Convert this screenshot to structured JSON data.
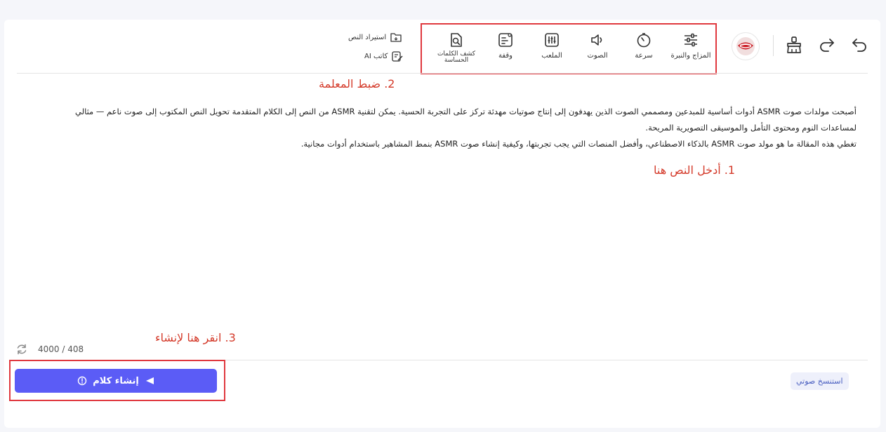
{
  "toolbar": {
    "items": [
      {
        "label": "المزاج والنبرة",
        "icon": "sliders-icon"
      },
      {
        "label": "سرعة",
        "icon": "timer-icon"
      },
      {
        "label": "الصوت",
        "icon": "speaker-icon"
      },
      {
        "label": "الملعب",
        "icon": "equalizer-icon"
      },
      {
        "label": "وقفة",
        "icon": "pause-insert-icon"
      },
      {
        "label": "كشف الكلمات الحساسة",
        "icon": "document-search-icon"
      }
    ],
    "import_text": "استيراد النص",
    "ai_writer": "كاتب AI"
  },
  "editor": {
    "lines": [
      "أصبحت مولدات صوت ASMR أدوات أساسية للمبدعين ومصممي الصوت الذين يهدفون إلى إنتاج صوتيات مهدئة تركز على التجربة الحسية. يمكن لتقنية ASMR من النص إلى الكلام المتقدمة تحويل النص المكتوب إلى صوت ناعم — مثالي",
      "لمساعدات النوم ومحتوى التأمل والموسيقى التصويرية المريحة.",
      "تغطي هذه المقالة ما هو مولد صوت ASMR بالذكاء الاصطناعي، وأفضل المنصات التي يجب تجربتها، وكيفية إنشاء صوت ASMR بنمط المشاهير باستخدام أدوات مجانية."
    ],
    "char_count": "4000 / 408"
  },
  "annotations": {
    "step1": "1. أدخل النص هنا",
    "step2": "2. ضبط المعلمة",
    "step3": "3. انقر هنا لإنشاء"
  },
  "footer": {
    "generate_label": "إنشاء كلام",
    "voice_clone_label": "استنسخ صوتي"
  },
  "colors": {
    "accent": "#5b5cf6",
    "annotation": "#e0383e"
  }
}
